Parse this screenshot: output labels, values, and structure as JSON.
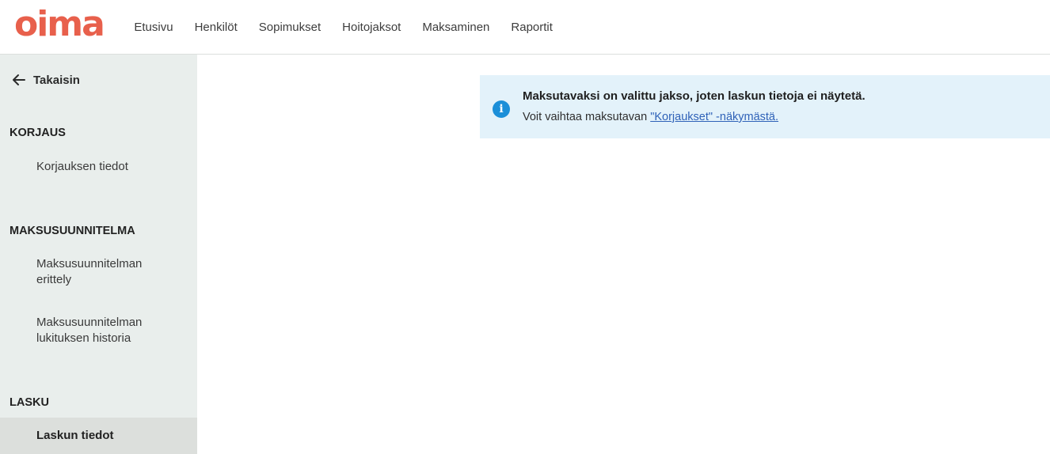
{
  "colors": {
    "brand": "#e8604c",
    "sidebar_bg": "#e9eeec",
    "active_item_bg": "#dcdfdc",
    "notice_bg": "#e3f2fa",
    "info_icon": "#1b8fd8",
    "link": "#2f62b8"
  },
  "header": {
    "logo_text": "oima",
    "nav": [
      "Etusivu",
      "Henkilöt",
      "Sopimukset",
      "Hoitojaksot",
      "Maksaminen",
      "Raportit"
    ]
  },
  "sidebar": {
    "back_label": "Takaisin",
    "back_icon": "arrow-left-icon",
    "sections": [
      {
        "title": "KORJAUS",
        "items": [
          "Korjauksen tiedot"
        ]
      },
      {
        "title": "MAKSUSUUNNITELMA",
        "items": [
          "Maksusuunnitelman erittely",
          "Maksusuunnitelman lukituksen historia"
        ]
      },
      {
        "title": "LASKU",
        "items": [
          "Laskun tiedot"
        ]
      }
    ],
    "active_item": "Laskun tiedot"
  },
  "notice": {
    "icon": "info-icon",
    "icon_glyph": "i",
    "title": "Maksutavaksi on valittu jakso, joten laskun tietoja ei näytetä.",
    "text_prefix": "Voit vaihtaa maksutavan ",
    "link_text": "\"Korjaukset\" -näkymästä."
  }
}
